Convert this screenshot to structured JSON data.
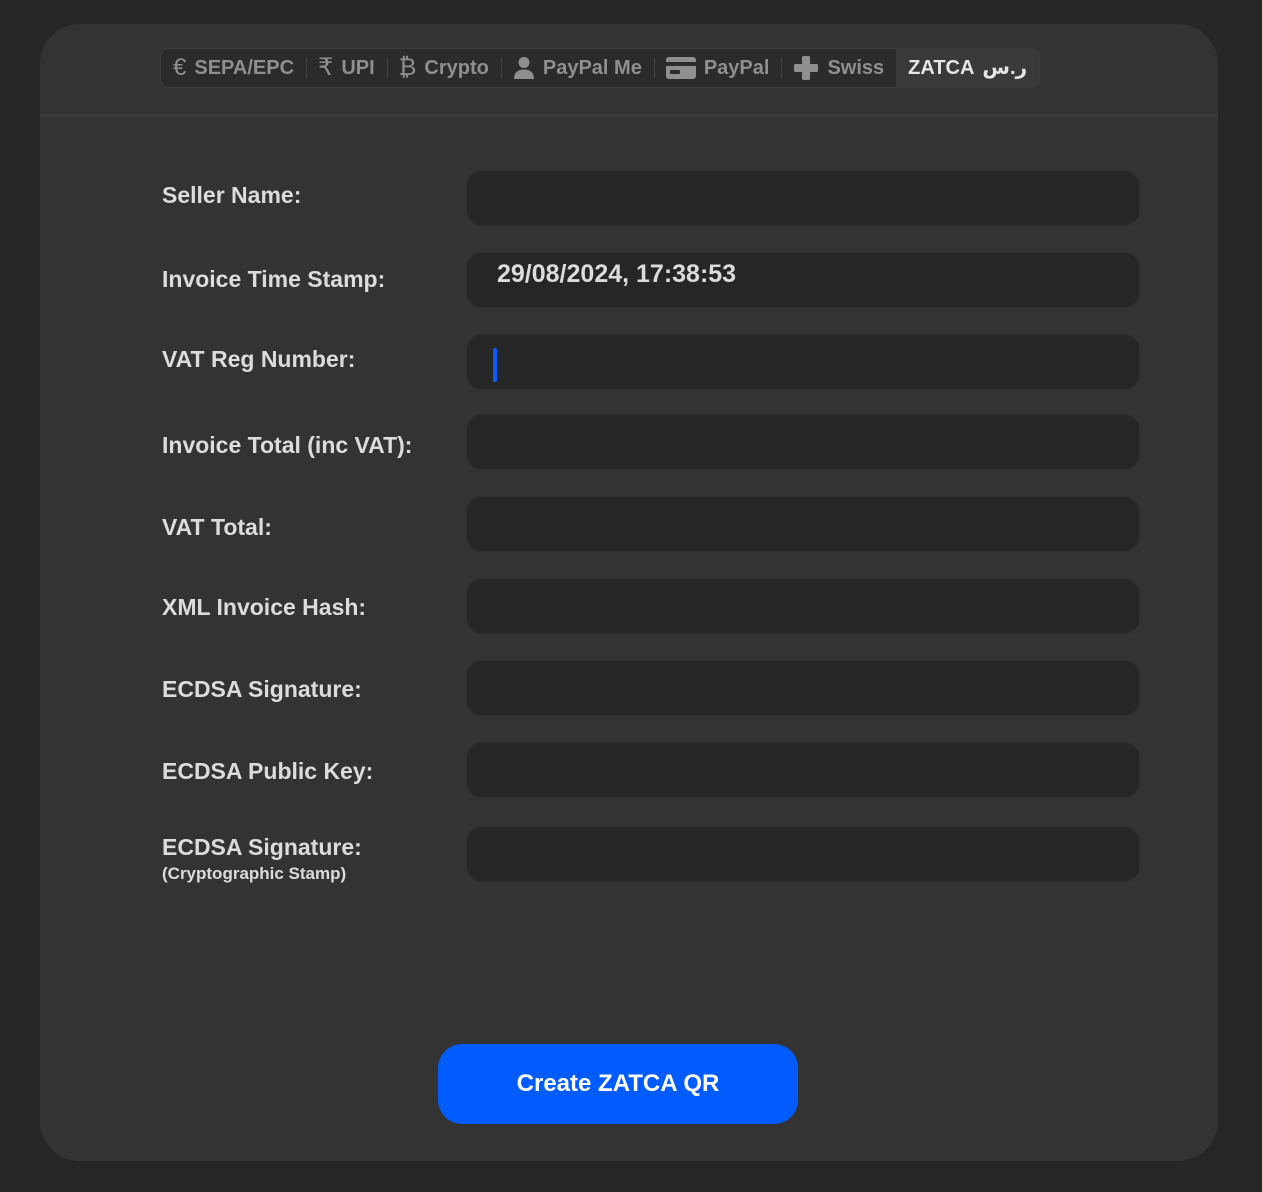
{
  "tabs": [
    {
      "label": "SEPA/EPC",
      "icon": "euro-icon",
      "glyph": "€"
    },
    {
      "label": "UPI",
      "icon": "rupee-icon",
      "glyph": "₹"
    },
    {
      "label": "Crypto",
      "icon": "bitcoin-icon",
      "glyph": "₿"
    },
    {
      "label": "PayPal Me",
      "icon": "person-icon"
    },
    {
      "label": "PayPal",
      "icon": "credit-card-icon"
    },
    {
      "label": "Swiss",
      "icon": "swiss-cross-icon"
    },
    {
      "label": "ZATCA",
      "icon": "riyal-icon",
      "glyph": "ر.س",
      "active": true
    }
  ],
  "form": {
    "seller_name": {
      "label": "Seller Name:",
      "value": ""
    },
    "invoice_time_stamp": {
      "label": "Invoice Time Stamp:",
      "value": "29/08/2024, 17:38:53"
    },
    "vat_reg_number": {
      "label": "VAT Reg Number:",
      "value": ""
    },
    "invoice_total": {
      "label": "Invoice Total (inc VAT):",
      "value": ""
    },
    "vat_total": {
      "label": "VAT Total:",
      "value": ""
    },
    "xml_invoice_hash": {
      "label": "XML Invoice Hash:",
      "value": ""
    },
    "ecdsa_signature": {
      "label": "ECDSA Signature:",
      "value": ""
    },
    "ecdsa_public_key": {
      "label": "ECDSA Public Key:",
      "value": ""
    },
    "ecdsa_stamp": {
      "label": "ECDSA Signature:",
      "sublabel": "(Cryptographic Stamp)",
      "value": ""
    }
  },
  "create_button": {
    "label": "Create ZATCA QR"
  },
  "colors": {
    "accent": "#005cff",
    "caret": "#0a5cff",
    "panel": "#333333",
    "background": "#262626",
    "field": "#262626"
  }
}
